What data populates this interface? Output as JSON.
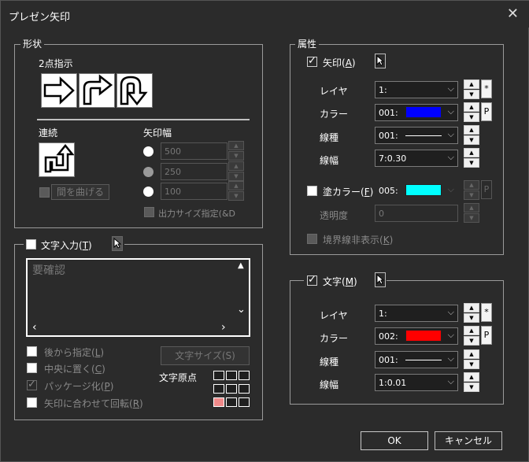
{
  "window": {
    "title": "プレゼン矢印",
    "close_glyph": "✕"
  },
  "shape_group": {
    "legend": "形状",
    "two_point": "2点指示",
    "continuous": "連続",
    "arrow_width": "矢印幅",
    "width_options": [
      "500",
      "250",
      "100"
    ],
    "bend_gap": "間を曲げる",
    "output_size": "出力サイズ指定(&D"
  },
  "text_input_group": {
    "legend": "文字入力(",
    "legend_key": "T",
    "legend_end": ")",
    "textarea_value": "要確認",
    "later": "後から指定(",
    "later_key": "L",
    "center": "中央に置く(",
    "center_key": "C",
    "package": "パッケージ化(",
    "package_key": "P",
    "rotate": "矢印に合わせて回転(",
    "rotate_key": "R",
    "close": ")",
    "text_size_btn": "文字サイズ(S)",
    "text_origin": "文字原点"
  },
  "attr_group": {
    "legend": "属性",
    "arrow": {
      "label": "矢印(",
      "key": "A",
      "close": ")",
      "layer_label": "レイヤ",
      "layer_value": "1:",
      "color_label": "カラー",
      "color_value": "001:",
      "color_hex": "#0000ff",
      "linetype_label": "線種",
      "linetype_value": "001:",
      "linewidth_label": "線幅",
      "linewidth_value": "7:0.30",
      "star": "*",
      "p": "P"
    },
    "fill": {
      "label": "塗カラー(",
      "key": "F",
      "close": ")",
      "color_value": "005:",
      "color_hex": "#00ffff",
      "opacity_label": "透明度",
      "opacity_value": "0",
      "p": "P",
      "hide_border": "境界線非表示(",
      "hide_border_key": "K",
      "hide_border_close": ")"
    }
  },
  "text_attr_group": {
    "label": "文字(",
    "key": "M",
    "close": ")",
    "layer_label": "レイヤ",
    "layer_value": "1:",
    "color_label": "カラー",
    "color_value": "002:",
    "color_hex": "#ff0000",
    "linetype_label": "線種",
    "linetype_value": "001:",
    "linewidth_label": "線幅",
    "linewidth_value": "1:0.01",
    "star": "*",
    "p": "P"
  },
  "footer": {
    "ok": "OK",
    "cancel": "キャンセル"
  }
}
